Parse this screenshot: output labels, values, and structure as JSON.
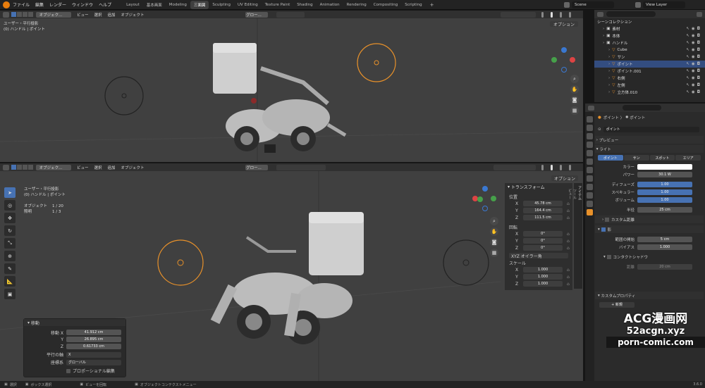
{
  "topbar": {
    "menu": [
      "ファイル",
      "編集",
      "レンダー",
      "ウィンドウ",
      "ヘルプ"
    ],
    "workspaces": [
      "Layout",
      "基本画面",
      "Modeling",
      "三面図",
      "Sculpting",
      "UV Editing",
      "Texture Paint",
      "Shading",
      "Animation",
      "Rendering",
      "Compositing",
      "Scripting"
    ],
    "active_workspace": "三面図",
    "plus": "+",
    "scene": "Scene",
    "view_layer": "View Layer"
  },
  "vp_top": {
    "header_mode": "オブジェク...",
    "menus": [
      "ビュー",
      "選択",
      "追加",
      "オブジェクト"
    ],
    "shading": "グロー...",
    "options": "オプション",
    "view_name": "ユーザー・平行投影",
    "object_info": "(0) ハンドル | ポイント"
  },
  "vp_bottom": {
    "header_mode": "オブジェク...",
    "menus": [
      "ビュー",
      "選択",
      "追加",
      "オブジェクト"
    ],
    "shading": "グロー...",
    "options": "オプション",
    "view_name": "ユーザー・平行投影",
    "object_info": "(0) ハンドル | ポイント",
    "stats": [
      {
        "label": "オブジェクト",
        "value": "1 / 20"
      },
      {
        "label": "照明",
        "value": "1 / 3"
      }
    ]
  },
  "transform": {
    "title": "トランスフォーム",
    "location_label": "位置",
    "location": [
      {
        "axis": "X",
        "value": "45.78 cm"
      },
      {
        "axis": "Y",
        "value": "164.4 cm"
      },
      {
        "axis": "Z",
        "value": "111.5 cm"
      }
    ],
    "rotation_label": "回転",
    "rotation": [
      {
        "axis": "X",
        "value": "0°"
      },
      {
        "axis": "Y",
        "value": "0°"
      },
      {
        "axis": "Z",
        "value": "0°"
      }
    ],
    "rotation_mode": "XYZ オイラー角",
    "scale_label": "スケール",
    "scale": [
      {
        "axis": "X",
        "value": "1.000"
      },
      {
        "axis": "Y",
        "value": "1.000"
      },
      {
        "axis": "Z",
        "value": "1.000"
      }
    ]
  },
  "sidetabs": [
    "アイテム",
    "ツール",
    "ビュー"
  ],
  "move_panel": {
    "title": "移動",
    "move_label": "移動",
    "values": [
      {
        "axis": "X",
        "value": "41.912 cm"
      },
      {
        "axis": "Y",
        "value": "26.895 cm"
      },
      {
        "axis": "Z",
        "value": "0.61733 cm"
      }
    ],
    "orient_axis_label": "平行の軸",
    "orient_axis": "X",
    "orientation_label": "座標系",
    "orientation": "グローバル",
    "proportional": "プロポーショナル編集"
  },
  "outliner": {
    "root": "シーンコレクション",
    "rows": [
      {
        "name": "素材",
        "indent": 1
      },
      {
        "name": "本体",
        "indent": 1
      },
      {
        "name": "ハンドル",
        "indent": 1
      },
      {
        "name": "Cube",
        "indent": 2
      },
      {
        "name": "サン",
        "indent": 2
      },
      {
        "name": "ポイント",
        "indent": 2,
        "selected": true
      },
      {
        "name": "ポイント.001",
        "indent": 2
      },
      {
        "name": "右側",
        "indent": 2
      },
      {
        "name": "左側",
        "indent": 2
      },
      {
        "name": "立方体.010",
        "indent": 2
      }
    ]
  },
  "props": {
    "breadcrumb": [
      "ポイント",
      "ポイント"
    ],
    "datablock": "ポイント",
    "preview": "プレビュー",
    "light": "ライト",
    "light_types": [
      "ポイント",
      "サン",
      "スポット",
      "エリア"
    ],
    "active_light_type": "ポイント",
    "color_label": "カラー",
    "power_label": "パワー",
    "power": "30.1 W",
    "diffuse_label": "ディフューズ",
    "diffuse": "1.00",
    "specular_label": "スペキュラー",
    "specular": "1.00",
    "volume_label": "ボリューム",
    "volume": "1.00",
    "radius_label": "半径",
    "radius": "25 cm",
    "custom_distance": "カスタム距離",
    "shadow": "影",
    "clip_start_label": "範囲の開始",
    "clip_start": "5 cm",
    "bias_label": "バイアス",
    "bias": "1.000",
    "contact_shadow": "コンタクトシャドウ",
    "distance_label": "距離",
    "distance": "20 cm",
    "custom_props": "カスタムプロパティ",
    "new": "新規"
  },
  "status": {
    "select": "選択",
    "box_select": "ボックス選択",
    "rotate_view": "ビューを回転",
    "context_menu": "オブジェクトコンテクストメニュー",
    "version": "3.6.0"
  },
  "watermark": [
    "ACG漫画网",
    "52acgn.xyz",
    "porn-comic.com"
  ],
  "colors": {
    "selected_orange": "#e8912a",
    "accent_blue": "#4772b3",
    "viewport_bg": "#404040"
  }
}
